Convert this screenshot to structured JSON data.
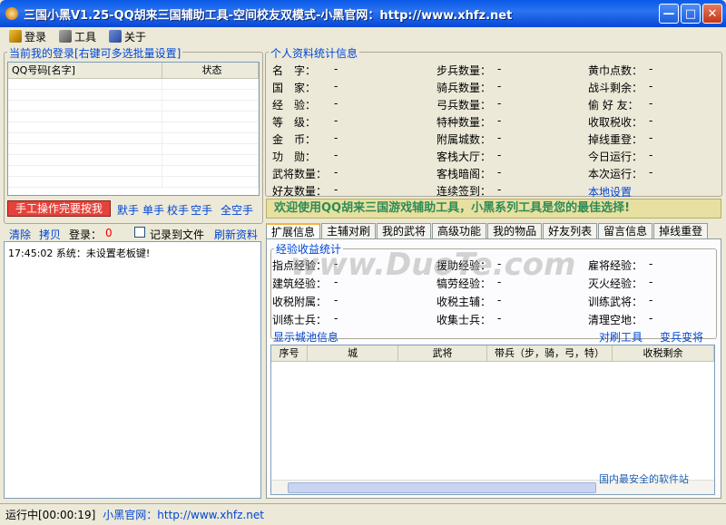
{
  "window": {
    "title": "三国小黑V1.25-QQ胡来三国辅助工具-空间校友双模式-小黑官网：http://www.xhfz.net"
  },
  "menu": [
    {
      "label": "登录"
    },
    {
      "label": "工具"
    },
    {
      "label": "关于"
    }
  ],
  "left": {
    "group_title": "当前我的登录[右键可多选批量设置]",
    "columns": [
      "QQ号码[名字]",
      "状态"
    ],
    "manual_button": "手工操作完要按我",
    "actions": [
      "默手",
      "单手",
      "校手",
      "空手",
      "全空手"
    ],
    "clear": "清除",
    "copy": "拷贝",
    "login_label": "登录：",
    "login_count": "0",
    "record_label": "记录到文件",
    "refresh": "刷新资料",
    "log_text": "17:45:02 系统：未设置老板键!"
  },
  "stats": {
    "group_title": "个人资料统计信息",
    "col1": [
      [
        "名　字：",
        "-"
      ],
      [
        "国　家：",
        "-"
      ],
      [
        "经　验：",
        "-"
      ],
      [
        "等　级：",
        "-"
      ],
      [
        "金　币：",
        "-"
      ],
      [
        "功　勋：",
        "-"
      ],
      [
        "武将数量：",
        "-"
      ],
      [
        "好友数量：",
        "-"
      ]
    ],
    "col2": [
      [
        "步兵数量：",
        "-"
      ],
      [
        "骑兵数量：",
        "-"
      ],
      [
        "弓兵数量：",
        "-"
      ],
      [
        "特种数量：",
        "-"
      ],
      [
        "附属城数：",
        "-"
      ],
      [
        "客栈大厅：",
        "-"
      ],
      [
        "客栈暗阁：",
        "-"
      ],
      [
        "连续签到：",
        "-"
      ]
    ],
    "col3": [
      [
        "黄巾点数：",
        "-"
      ],
      [
        "战斗剩余：",
        "-"
      ],
      [
        "偷 好 友：",
        "-"
      ],
      [
        "收取税收：",
        "-"
      ],
      [
        "掉线重登：",
        "-"
      ],
      [
        "今日运行：",
        "-"
      ],
      [
        "本次运行：",
        "-"
      ]
    ],
    "local_settings": "本地设置"
  },
  "banner": "欢迎使用QQ胡来三国游戏辅助工具，小黑系列工具是您的最佳选择!",
  "tabs": [
    "扩展信息",
    "主辅对刷",
    "我的武将",
    "高级功能",
    "我的物品",
    "好友列表",
    "留言信息",
    "掉线重登"
  ],
  "ext": {
    "group_title": "经验收益统计",
    "c1": [
      [
        "指点经验：",
        "-"
      ],
      [
        "建筑经验：",
        "-"
      ],
      [
        "收税附属：",
        "-"
      ],
      [
        "训练士兵：",
        "-"
      ]
    ],
    "c2": [
      [
        "援助经验：",
        "-"
      ],
      [
        "犒劳经验：",
        "-"
      ],
      [
        "收税主辅：",
        "-"
      ],
      [
        "收集士兵：",
        "-"
      ]
    ],
    "c3": [
      [
        "雇将经验：",
        "-"
      ],
      [
        "灭火经验：",
        "-"
      ],
      [
        "训练武将：",
        "-"
      ],
      [
        "清理空地：",
        "-"
      ]
    ],
    "show_city": "显示城池信息",
    "tool1": "对刷工具",
    "tool2": "变兵变将",
    "columns": [
      "序号",
      "城",
      "武将",
      "带兵（步，骑，弓，特）",
      "收税剩余"
    ]
  },
  "status": {
    "running": "运行中[00:00:19]",
    "site_label": "小黑官网：",
    "site_url": "http://www.xhfz.net"
  },
  "watermark": "www.DuoTe.com",
  "watermark2": "国内最安全的软件站"
}
